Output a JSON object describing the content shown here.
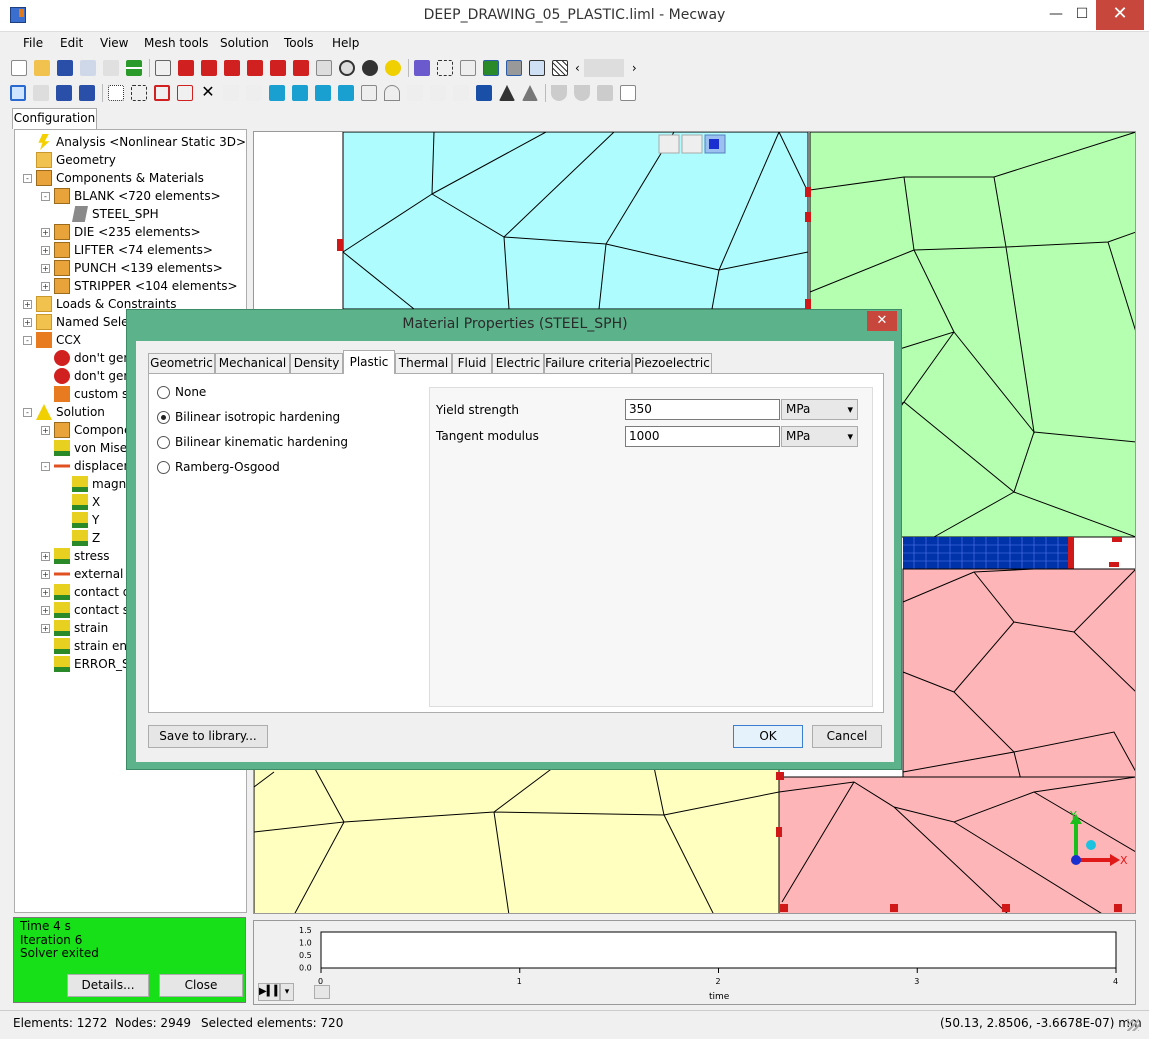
{
  "window": {
    "title": "DEEP_DRAWING_05_PLASTIC.liml - Mecway",
    "minimize": "—",
    "maximize": "☐",
    "close": "✕"
  },
  "menu": [
    "File",
    "Edit",
    "View",
    "Mesh tools",
    "Solution",
    "Tools",
    "Help"
  ],
  "config_tab": "Configuration",
  "tree": [
    {
      "label": "Analysis <Nonlinear Static 3D>",
      "level": 1,
      "icon": "bolt",
      "exp": ""
    },
    {
      "label": "Geometry",
      "level": 1,
      "icon": "folder",
      "exp": ""
    },
    {
      "label": "Components & Materials",
      "level": 1,
      "icon": "part",
      "exp": "-"
    },
    {
      "label": "BLANK <720 elements>",
      "level": 2,
      "icon": "part",
      "exp": "-"
    },
    {
      "label": "STEEL_SPH",
      "level": 3,
      "icon": "mat",
      "exp": ""
    },
    {
      "label": "DIE <235 elements>",
      "level": 2,
      "icon": "part",
      "exp": "+"
    },
    {
      "label": "LIFTER <74 elements>",
      "level": 2,
      "icon": "part",
      "exp": "+"
    },
    {
      "label": "PUNCH <139 elements>",
      "level": 2,
      "icon": "part",
      "exp": "+"
    },
    {
      "label": "STRIPPER <104 elements>",
      "level": 2,
      "icon": "part",
      "exp": "+"
    },
    {
      "label": "Loads & Constraints",
      "level": 1,
      "icon": "folder",
      "exp": "+"
    },
    {
      "label": "Named Selec",
      "level": 1,
      "icon": "folder",
      "exp": "+"
    },
    {
      "label": "CCX",
      "level": 1,
      "icon": "ccx",
      "exp": "-"
    },
    {
      "label": "don't gen",
      "level": 2,
      "icon": "no",
      "exp": ""
    },
    {
      "label": "don't gen",
      "level": 2,
      "icon": "no",
      "exp": ""
    },
    {
      "label": "custom s",
      "level": 2,
      "icon": "ccx",
      "exp": ""
    },
    {
      "label": "Solution",
      "level": 1,
      "icon": "tri",
      "exp": "-"
    },
    {
      "label": "Compone",
      "level": 2,
      "icon": "part",
      "exp": "+"
    },
    {
      "label": "von Mise",
      "level": 2,
      "icon": "warn",
      "exp": ""
    },
    {
      "label": "displacen",
      "level": 2,
      "icon": "arrow",
      "exp": "-"
    },
    {
      "label": "magn",
      "level": 3,
      "icon": "warn",
      "exp": ""
    },
    {
      "label": "X",
      "level": 3,
      "icon": "warn",
      "exp": ""
    },
    {
      "label": "Y",
      "level": 3,
      "icon": "warn",
      "exp": ""
    },
    {
      "label": "Z",
      "level": 3,
      "icon": "warn",
      "exp": ""
    },
    {
      "label": "stress",
      "level": 2,
      "icon": "warn",
      "exp": "+"
    },
    {
      "label": "external f",
      "level": 2,
      "icon": "arrow",
      "exp": "+"
    },
    {
      "label": "contact d",
      "level": 2,
      "icon": "warn",
      "exp": "+"
    },
    {
      "label": "contact s",
      "level": 2,
      "icon": "warn",
      "exp": "+"
    },
    {
      "label": "strain",
      "level": 2,
      "icon": "warn",
      "exp": "+"
    },
    {
      "label": "strain ene",
      "level": 2,
      "icon": "warn",
      "exp": ""
    },
    {
      "label": "ERROR_S",
      "level": 2,
      "icon": "warn",
      "exp": ""
    }
  ],
  "solver": {
    "time": "Time 4 s",
    "iteration": "Iteration 6",
    "status": "Solver exited",
    "details_btn": "Details...",
    "close_btn": "Close"
  },
  "timeplot": {
    "yticks": [
      "1.5",
      "1.0",
      "0.5",
      "0.0"
    ],
    "xticks": [
      "0",
      "1",
      "2",
      "3",
      "4"
    ],
    "xlabel": "time"
  },
  "statusbar": {
    "elements": "Elements: 1272",
    "nodes": "Nodes: 2949",
    "selected": "Selected elements: 720",
    "coords": "(50.13, 2.8506, -3.6678E-07) mm"
  },
  "axes": {
    "y": "Y",
    "x": "X"
  },
  "dialog": {
    "title": "Material Properties (STEEL_SPH)",
    "tabs": [
      "Geometric",
      "Mechanical",
      "Density",
      "Plastic",
      "Thermal",
      "Fluid",
      "Electric",
      "Failure criteria",
      "Piezoelectric"
    ],
    "active_tab": "Plastic",
    "options": [
      {
        "label": "None",
        "selected": false
      },
      {
        "label": "Bilinear isotropic hardening",
        "selected": true
      },
      {
        "label": "Bilinear kinematic hardening",
        "selected": false
      },
      {
        "label": "Ramberg-Osgood",
        "selected": false
      }
    ],
    "props": [
      {
        "label": "Yield strength",
        "value": "350",
        "unit": "MPa"
      },
      {
        "label": "Tangent modulus",
        "value": "1000",
        "unit": "MPa"
      }
    ],
    "save_btn": "Save to library...",
    "ok_btn": "OK",
    "cancel_btn": "Cancel",
    "close": "✕"
  },
  "colors": {
    "die": "#aefcfd",
    "punch": "#b5ffb0",
    "blank": "#0033aa",
    "stripper": "#feb5b8",
    "lifter": "#ffffc0",
    "constraint": "#d01818",
    "solver_ok": "#18e018",
    "dialog_frame": "#5cb38b"
  }
}
